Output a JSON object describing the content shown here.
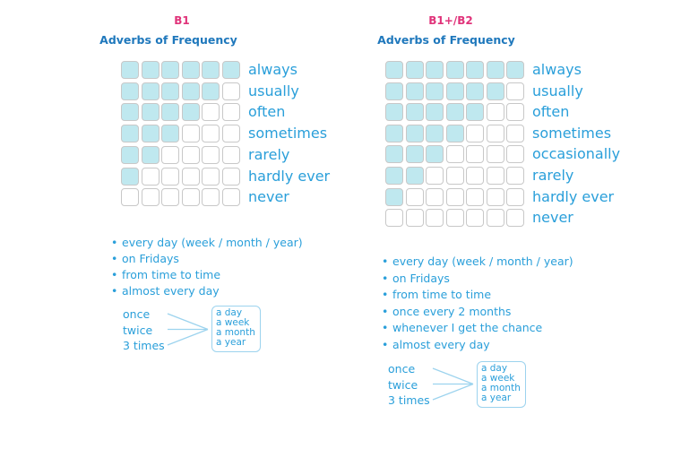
{
  "colors": {
    "level": "#e0337a",
    "title": "#1f78bc",
    "text": "#2a9fda",
    "filled": "#bfe8ef",
    "empty_border": "#c8c8c8"
  },
  "panels": [
    {
      "level": "B1",
      "title": "Adverbs of Frequency",
      "columns": 6,
      "rows": [
        {
          "label": "always",
          "filled": 6
        },
        {
          "label": "usually",
          "filled": 5
        },
        {
          "label": "often",
          "filled": 4
        },
        {
          "label": "sometimes",
          "filled": 3
        },
        {
          "label": "rarely",
          "filled": 2
        },
        {
          "label": "hardly ever",
          "filled": 1
        },
        {
          "label": "never",
          "filled": 0
        }
      ],
      "expressions": [
        "every day (week / month / year)",
        "on Fridays",
        "from time to time",
        "almost every day"
      ],
      "counts": [
        "once",
        "twice",
        "3 times"
      ],
      "periods": [
        "a day",
        "a week",
        "a month",
        "a year"
      ]
    },
    {
      "level": "B1+/B2",
      "title": "Adverbs of Frequency",
      "columns": 7,
      "rows": [
        {
          "label": "always",
          "filled": 7
        },
        {
          "label": "usually",
          "filled": 6
        },
        {
          "label": "often",
          "filled": 5
        },
        {
          "label": "sometimes",
          "filled": 4
        },
        {
          "label": "occasionally",
          "filled": 3
        },
        {
          "label": "rarely",
          "filled": 2
        },
        {
          "label": "hardly ever",
          "filled": 1
        },
        {
          "label": "never",
          "filled": 0
        }
      ],
      "expressions": [
        "every day (week / month / year)",
        "on Fridays",
        "from time to time",
        "once every 2 months",
        "whenever I get the chance",
        "almost every day"
      ],
      "counts": [
        "once",
        "twice",
        "3 times"
      ],
      "periods": [
        "a day",
        "a week",
        "a month",
        "a year"
      ]
    }
  ]
}
